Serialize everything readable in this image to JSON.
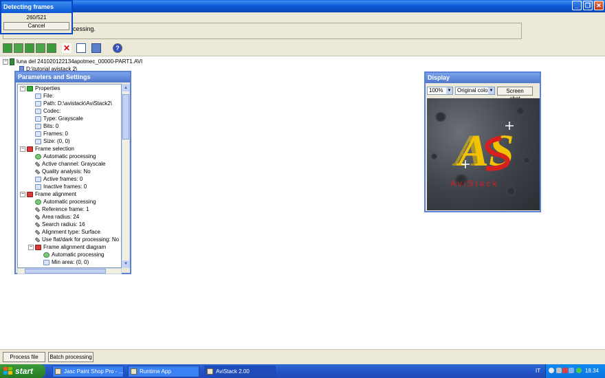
{
  "detect_dialog": {
    "title": "Detecting frames",
    "count": "260/521",
    "cancel_label": "Cancel"
  },
  "status": {
    "text": "cessing."
  },
  "toolbar": {
    "icons": [
      "open-green-icon",
      "open-green-icon",
      "open-green-icon",
      "open-green-icon",
      "open-green-icon",
      "delete-x-icon",
      "new-document-icon",
      "save-icon",
      "help-icon"
    ]
  },
  "tree": {
    "root_label": "luna del 241020122134apotmec_00000-PART1.AVI",
    "child_label": "D:\\tutorial avistack 2\\"
  },
  "params_panel": {
    "title": "Parameters and Settings",
    "nodes": [
      {
        "label": "Properties",
        "level": 0,
        "icon": "folder-green",
        "expander": "−"
      },
      {
        "label": "File:",
        "level": 1,
        "icon": "doc"
      },
      {
        "label": "Path: D:\\avistack\\AviStack2\\",
        "level": 1,
        "icon": "doc"
      },
      {
        "label": "Codec:",
        "level": 1,
        "icon": "doc"
      },
      {
        "label": "Type: Grayscale",
        "level": 1,
        "icon": "doc"
      },
      {
        "label": "Bits: 0",
        "level": 1,
        "icon": "doc"
      },
      {
        "label": "Frames: 0",
        "level": 1,
        "icon": "doc"
      },
      {
        "label": "Size: (0, 0)",
        "level": 1,
        "icon": "doc"
      },
      {
        "label": "Frame selection",
        "level": 0,
        "icon": "folder-red",
        "expander": "−"
      },
      {
        "label": "Automatic processing",
        "level": 1,
        "icon": "gear"
      },
      {
        "label": "Active channel: Grayscale",
        "level": 1,
        "icon": "wrench"
      },
      {
        "label": "Quality analysis: No",
        "level": 1,
        "icon": "wrench"
      },
      {
        "label": "Active frames: 0",
        "level": 1,
        "icon": "doc"
      },
      {
        "label": "Inactive frames: 0",
        "level": 1,
        "icon": "doc"
      },
      {
        "label": "Frame alignment",
        "level": 0,
        "icon": "folder-red",
        "expander": "−"
      },
      {
        "label": "Automatic processing",
        "level": 1,
        "icon": "gear"
      },
      {
        "label": "Reference frame: 1",
        "level": 1,
        "icon": "wrench"
      },
      {
        "label": "Area radius: 24",
        "level": 1,
        "icon": "wrench"
      },
      {
        "label": "Search radius: 16",
        "level": 1,
        "icon": "wrench"
      },
      {
        "label": "Alignment type: Surface",
        "level": 1,
        "icon": "wrench"
      },
      {
        "label": "Use flat/dark for processing: No",
        "level": 1,
        "icon": "wrench"
      },
      {
        "label": "Frame alignment diagram",
        "level": 1,
        "icon": "folder-red",
        "expander": "−"
      },
      {
        "label": "Automatic processing",
        "level": 2,
        "icon": "gear"
      },
      {
        "label": "Min area: (0, 0)",
        "level": 2,
        "icon": "doc"
      }
    ]
  },
  "display_panel": {
    "title": "Display",
    "zoom": "100%",
    "color_mode": "Original color",
    "screenshot_label": "Screen shot",
    "logo_letters": "AS",
    "logo_text": "AviStack"
  },
  "bottom": {
    "process_file_label": "Process file",
    "batch_label": "Batch processing"
  },
  "taskbar": {
    "start_label": "start",
    "tasks": [
      {
        "label": "Jasc Paint Shop Pro - ..."
      },
      {
        "label": "Runtime App"
      },
      {
        "label": "AviStack 2.00"
      }
    ],
    "lang": "IT",
    "clock": "18.34"
  },
  "colors": {
    "title_blue": "#0b57d3",
    "panel_title": "#5a7fd6",
    "logo_yellow": "#f2c200",
    "logo_red": "#d62020",
    "taskbar_blue": "#2454c6",
    "start_green": "#2f8c2f"
  }
}
